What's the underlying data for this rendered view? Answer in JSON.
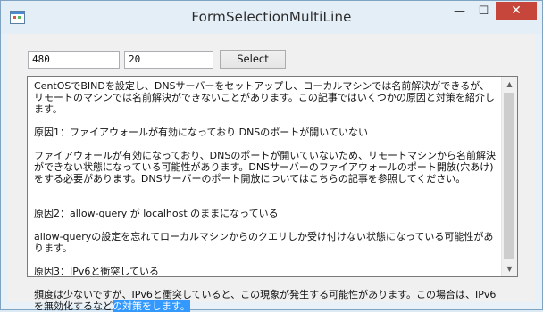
{
  "window": {
    "title": "FormSelectionMultiLine",
    "minimize": "—",
    "maximize": "☐",
    "close": "✕"
  },
  "inputs": {
    "start_value": "480",
    "length_value": "20"
  },
  "select_button": "Select",
  "textbox": {
    "p1": "CentOSでBINDを設定し、DNSサーバーをセットアップし、ローカルマシンでは名前解決ができるが、リモートのマシンでは名前解決ができないことがあります。この記事ではいくつかの原因と対策を紹介します。",
    "p2": "原因1：ファイアウォールが有効になっており DNSのポートが開いていない",
    "p3": "ファイアウォールが有効になっており、DNSのポートが開いていないため、リモートマシンから名前解決ができない状態になっている可能性があります。DNSサーバーのファイアウォールのポート開放(穴あけ)をする必要があります。DNSサーバーのポート開放についてはこちらの記事を参照してください。",
    "p4": "原因2：allow-query が localhost のままになっている",
    "p5": "allow-queryの設定を忘れてローカルマシンからのクエリしか受け付けない状態になっている可能性があります。",
    "p6": "原因3：IPv6と衝突している",
    "p7_before": "頻度は少ないですが、IPv6と衝突していると、この現象が発生する可能性があります。この場合は、IPv6を無効化するなど",
    "p7_selected": "の対策をします。"
  },
  "scrollbar": {
    "up_arrow": "▲",
    "down_arrow": "▼"
  }
}
